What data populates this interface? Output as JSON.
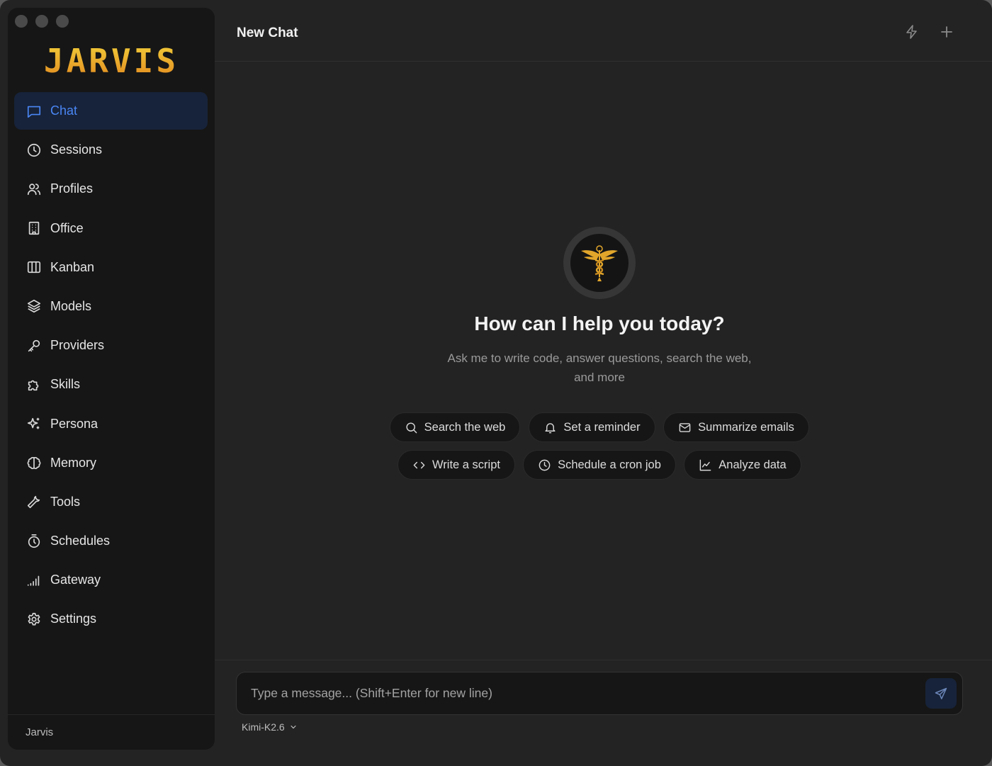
{
  "app": {
    "logo_text": "JARVIS",
    "user_name": "Jarvis"
  },
  "colors": {
    "accent": "#4a86f5",
    "active_bg": "#17233a",
    "logo_gold": "#e8a52a"
  },
  "sidebar": {
    "items": [
      {
        "label": "Chat",
        "icon": "chat-icon",
        "active": true
      },
      {
        "label": "Sessions",
        "icon": "clock-icon"
      },
      {
        "label": "Profiles",
        "icon": "users-icon"
      },
      {
        "label": "Office",
        "icon": "building-icon"
      },
      {
        "label": "Kanban",
        "icon": "columns-icon"
      },
      {
        "label": "Models",
        "icon": "layers-icon"
      },
      {
        "label": "Providers",
        "icon": "key-icon"
      },
      {
        "label": "Skills",
        "icon": "puzzle-icon"
      },
      {
        "label": "Persona",
        "icon": "sparkles-icon"
      },
      {
        "label": "Memory",
        "icon": "brain-icon"
      },
      {
        "label": "Tools",
        "icon": "wrench-icon"
      },
      {
        "label": "Schedules",
        "icon": "timer-icon"
      },
      {
        "label": "Gateway",
        "icon": "signal-icon"
      },
      {
        "label": "Settings",
        "icon": "gear-icon"
      }
    ]
  },
  "header": {
    "title": "New Chat"
  },
  "main": {
    "greeting": "How can I help you today?",
    "subtext_line1": "Ask me to write code, answer questions, search the web,",
    "subtext_line2": "and more",
    "suggestions": [
      {
        "label": "Search the web",
        "icon": "search-icon"
      },
      {
        "label": "Set a reminder",
        "icon": "bell-icon"
      },
      {
        "label": "Summarize emails",
        "icon": "mail-icon"
      },
      {
        "label": "Write a script",
        "icon": "code-icon"
      },
      {
        "label": "Schedule a cron job",
        "icon": "clock-icon"
      },
      {
        "label": "Analyze data",
        "icon": "chart-icon"
      }
    ]
  },
  "composer": {
    "placeholder": "Type a message... (Shift+Enter for new line)",
    "value": "",
    "model": "Kimi-K2.6"
  }
}
